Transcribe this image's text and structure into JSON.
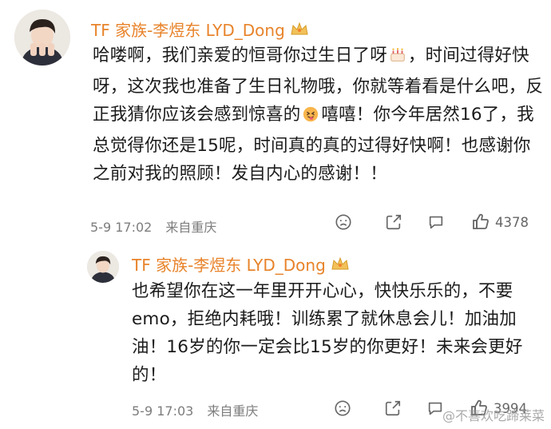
{
  "comment": {
    "username": "TF 家族-李煜东 LYD_Dong",
    "text_parts": [
      "哈喽啊，我们亲爱的恒哥你过生日了呀",
      "，时间过得好快呀，这次我也准备了生日礼物哦，你就等着看是什么吧，反正我猜你应该会感到惊喜的",
      "嘻嘻！你今年居然16了，我总觉得你还是15呢，时间真的真的过得好快啊！也感谢你之前对我的照顾！发自内心的感谢！！"
    ],
    "date": "5-9 17:02",
    "location": "来自重庆",
    "likes": "4378"
  },
  "reply": {
    "username": "TF 家族-李煜东 LYD_Dong",
    "text": "也希望你在这一年里开开心心，快快乐乐的，不要emo，拒绝内耗哦！训练累了就休息会儿！加油加油！16岁的你一定会比15岁的你更好！未来会更好的！",
    "date": "5-9 17:03",
    "location": "来自重庆",
    "likes": "3994"
  },
  "icons": [
    "avatar",
    "crown-badge-icon",
    "birthday-cake-emoji-icon",
    "tongue-out-emoji-icon",
    "sad-face-icon",
    "share-icon",
    "comment-icon",
    "thumbs-up-icon"
  ],
  "watermark": "@不喜欢吃蹄莱菜",
  "colors": {
    "username": "#e8832a",
    "meta": "#7d7d7d"
  }
}
